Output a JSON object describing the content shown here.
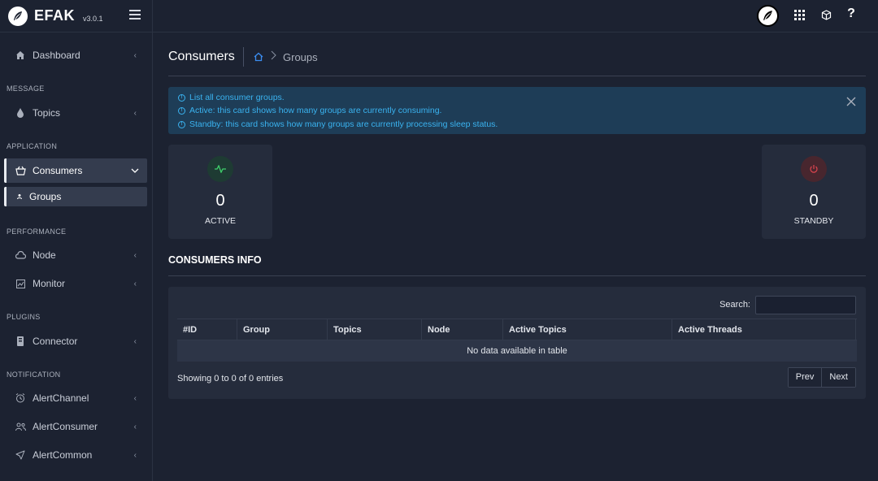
{
  "brand": {
    "name": "EFAK",
    "version": "v3.0.1"
  },
  "sidebar": {
    "items": [
      {
        "label": "Dashboard"
      },
      {
        "section": "MESSAGE"
      },
      {
        "label": "Topics"
      },
      {
        "section": "APPLICATION"
      },
      {
        "label": "Consumers"
      },
      {
        "label": "Groups"
      },
      {
        "section": "PERFORMANCE"
      },
      {
        "label": "Node"
      },
      {
        "label": "Monitor"
      },
      {
        "section": "PLUGINS"
      },
      {
        "label": "Connector"
      },
      {
        "section": "NOTIFICATION"
      },
      {
        "label": "AlertChannel"
      },
      {
        "label": "AlertConsumer"
      },
      {
        "label": "AlertCommon"
      }
    ]
  },
  "header": {
    "title": "Consumers",
    "breadcrumb": "Groups"
  },
  "alert": {
    "lines": [
      "List all consumer groups.",
      "Active: this card shows how many groups are currently consuming.",
      "Standby: this card shows how many groups are currently processing sleep status."
    ]
  },
  "cards": {
    "active": {
      "value": "0",
      "label": "ACTIVE",
      "color": "#3fd16b"
    },
    "standby": {
      "value": "0",
      "label": "STANDBY",
      "color": "#e0454f"
    }
  },
  "consumers_info": {
    "title": "CONSUMERS INFO",
    "search_label": "Search:",
    "columns": [
      "#ID",
      "Group",
      "Topics",
      "Node",
      "Active Topics",
      "Active Threads"
    ],
    "empty_text": "No data available in table",
    "info": "Showing 0 to 0 of 0 entries",
    "prev": "Prev",
    "next": "Next"
  }
}
